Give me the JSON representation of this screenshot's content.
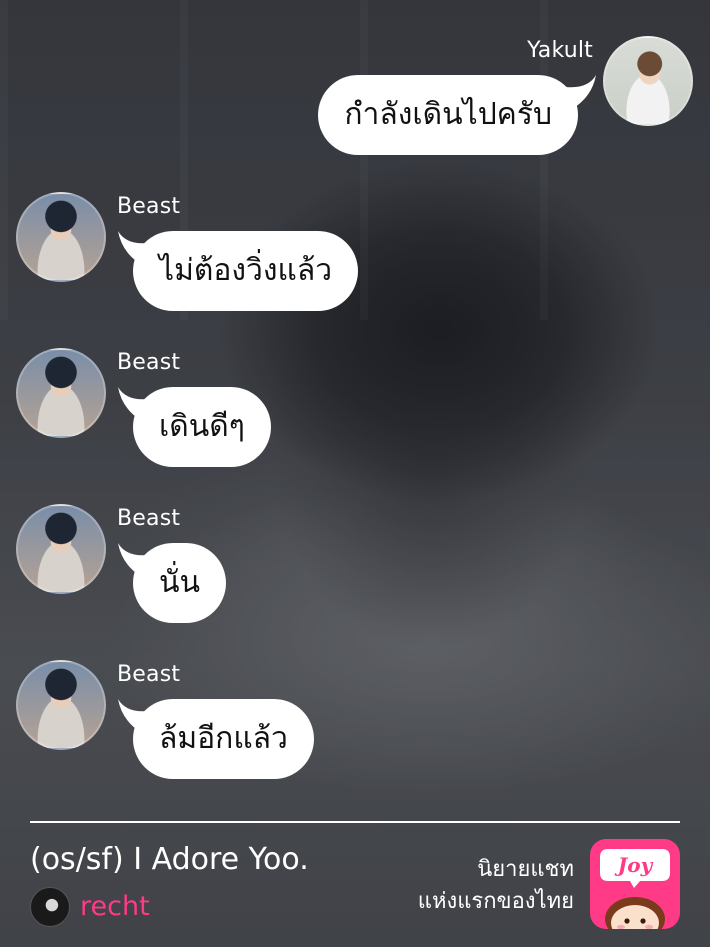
{
  "messages": [
    {
      "sender": "Yakult",
      "text": "กำลังเดินไปครับ",
      "side": "right"
    },
    {
      "sender": "Beast",
      "text": "ไม่ต้องวิ่งแล้ว",
      "side": "left"
    },
    {
      "sender": "Beast",
      "text": "เดินดีๆ",
      "side": "left"
    },
    {
      "sender": "Beast",
      "text": "นั่น",
      "side": "left"
    },
    {
      "sender": "Beast",
      "text": "ล้มอีกแล้ว",
      "side": "left"
    }
  ],
  "footer": {
    "story_title": "(os/sf) I Adore Yoo.",
    "author": "recht",
    "tagline_line1": "นิยายแชท",
    "tagline_line2": "แห่งแรกของไทย",
    "logo_text": "Joy"
  },
  "colors": {
    "bubble": "#ffffff",
    "author": "#ff3a86",
    "logo_bg": "#ff3a86"
  },
  "icons": {
    "logo": "joy-app-logo",
    "avatars": "user-avatar"
  }
}
